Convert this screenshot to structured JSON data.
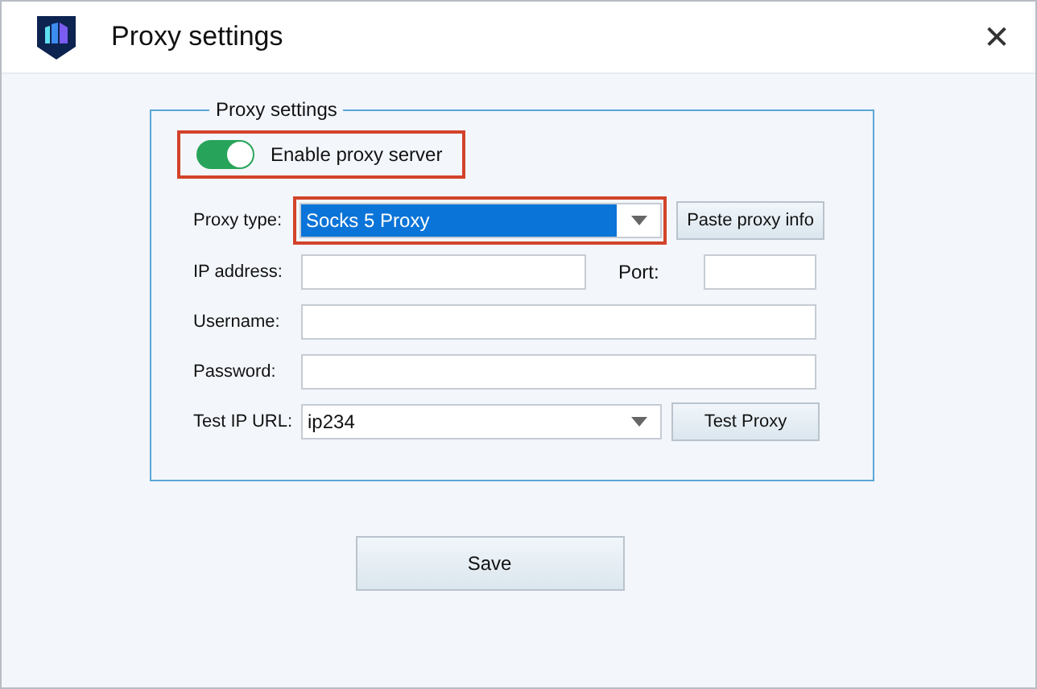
{
  "window": {
    "title": "Proxy settings",
    "close": "✕"
  },
  "group": {
    "title": "Proxy settings"
  },
  "enable": {
    "label": "Enable proxy server",
    "on": true,
    "highlighted": true
  },
  "proxy_type": {
    "label": "Proxy type:",
    "value": "Socks 5 Proxy",
    "highlighted": true,
    "button": "Paste proxy info"
  },
  "ip": {
    "label": "IP address:"
  },
  "port": {
    "label": "Port:"
  },
  "username": {
    "label": "Username:"
  },
  "password": {
    "label": "Password:"
  },
  "test_url": {
    "label": "Test IP URL:",
    "value": "ip234",
    "button": "Test Proxy"
  },
  "save": "Save"
}
